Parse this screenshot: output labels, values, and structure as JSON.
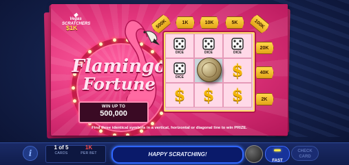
{
  "ticket": {
    "brand_line1": "Vegas",
    "brand_line2": "SCRATCHERS",
    "price": "$1K",
    "title_line1": "Flamingo",
    "title_line2": "Fortune",
    "win_label": "WIN UP TO",
    "win_amount": "500,000",
    "instructions": "Find three identical symbols in a vertical, horizontal or diagonal line to win PRIZE."
  },
  "prizes": {
    "top": [
      "500K",
      "1K",
      "10K",
      "5K",
      "100K"
    ],
    "right": [
      "20K",
      "40K",
      "2K"
    ]
  },
  "grid": {
    "cells": [
      {
        "symbol": "dice",
        "label": "DICE"
      },
      {
        "symbol": "dice",
        "label": "DICE"
      },
      {
        "symbol": "dice",
        "label": "DICE"
      },
      {
        "symbol": "dice",
        "label": "DICE"
      },
      {
        "symbol": "cover",
        "label": ""
      },
      {
        "symbol": "dollar",
        "label": "$"
      },
      {
        "symbol": "dollar",
        "label": "$"
      },
      {
        "symbol": "dollar",
        "label": "$"
      },
      {
        "symbol": "dollar",
        "label": "$"
      }
    ]
  },
  "bottom": {
    "cards_value": "1 of 5",
    "cards_label": "CARDS",
    "per_bet_value": "1K",
    "per_bet_label": "PER BET",
    "message": "HAPPY SCRATCHING!",
    "fast_label": "FAST",
    "check_label_1": "CHECK",
    "check_label_2": "CARD",
    "info_glyph": "i"
  },
  "colors": {
    "ticket_pink": "#e2357c",
    "gold": "#f2b400",
    "bar_blue": "#101d4c",
    "accent_blue": "#2f66ff"
  }
}
